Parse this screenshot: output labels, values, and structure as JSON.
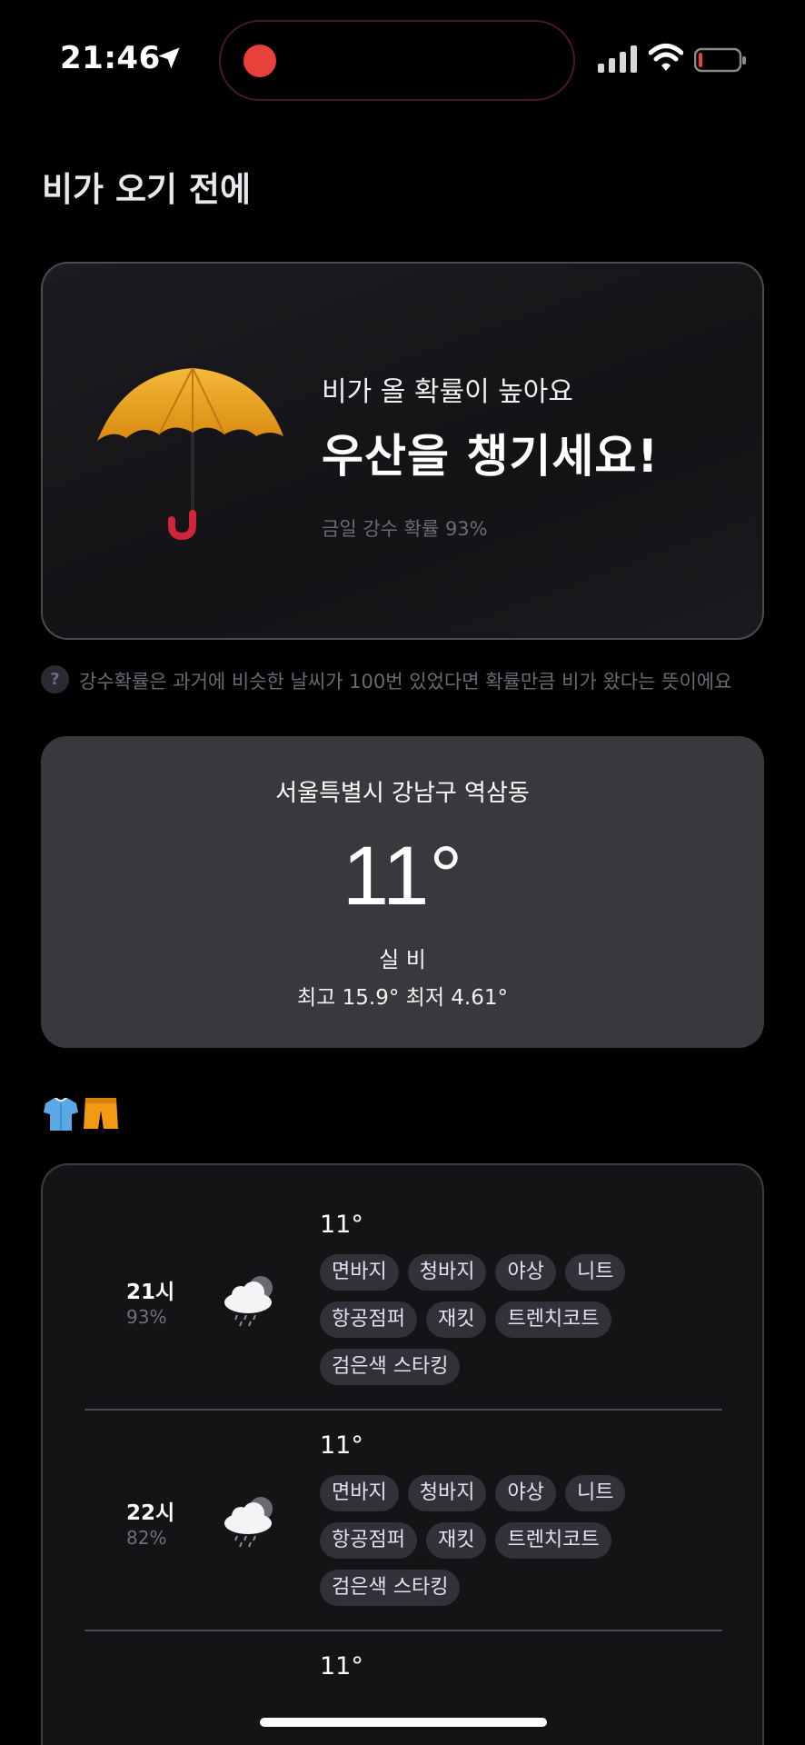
{
  "status_bar": {
    "time": "21:46"
  },
  "page_title": "비가 오기 전에",
  "rain_card": {
    "subtitle": "비가 올 확률이 높아요",
    "headline": "우산을 챙기세요!",
    "probability_text": "금일 강수 확률 93%"
  },
  "info": {
    "icon_glyph": "?",
    "text": "강수확률은 과거에 비슷한 날씨가 100번 있었다면 확률만큼 비가 왔다는 뜻이에요"
  },
  "location_card": {
    "location": "서울특별시 강남구 역삼동",
    "temperature": "11°",
    "condition": "실 비",
    "range": "최고 15.9° 최저 4.61°"
  },
  "clothes_icons": [
    "shirt-icon",
    "shorts-icon"
  ],
  "hourly": [
    {
      "time": "21시",
      "probability": "93%",
      "temperature": "11°",
      "tags": [
        "면바지",
        "청바지",
        "야상",
        "니트",
        "항공점퍼",
        "재킷",
        "트렌치코트",
        "검은색 스타킹"
      ]
    },
    {
      "time": "22시",
      "probability": "82%",
      "temperature": "11°",
      "tags": [
        "면바지",
        "청바지",
        "야상",
        "니트",
        "항공점퍼",
        "재킷",
        "트렌치코트",
        "검은색 스타킹"
      ]
    },
    {
      "time": "",
      "probability": "",
      "temperature": "11°",
      "tags": []
    }
  ],
  "colors": {
    "background": "#000000",
    "card": "#39393d",
    "tag_bg": "#313138",
    "tag_text": "#e6e0f0",
    "recording": "#e8413a"
  }
}
